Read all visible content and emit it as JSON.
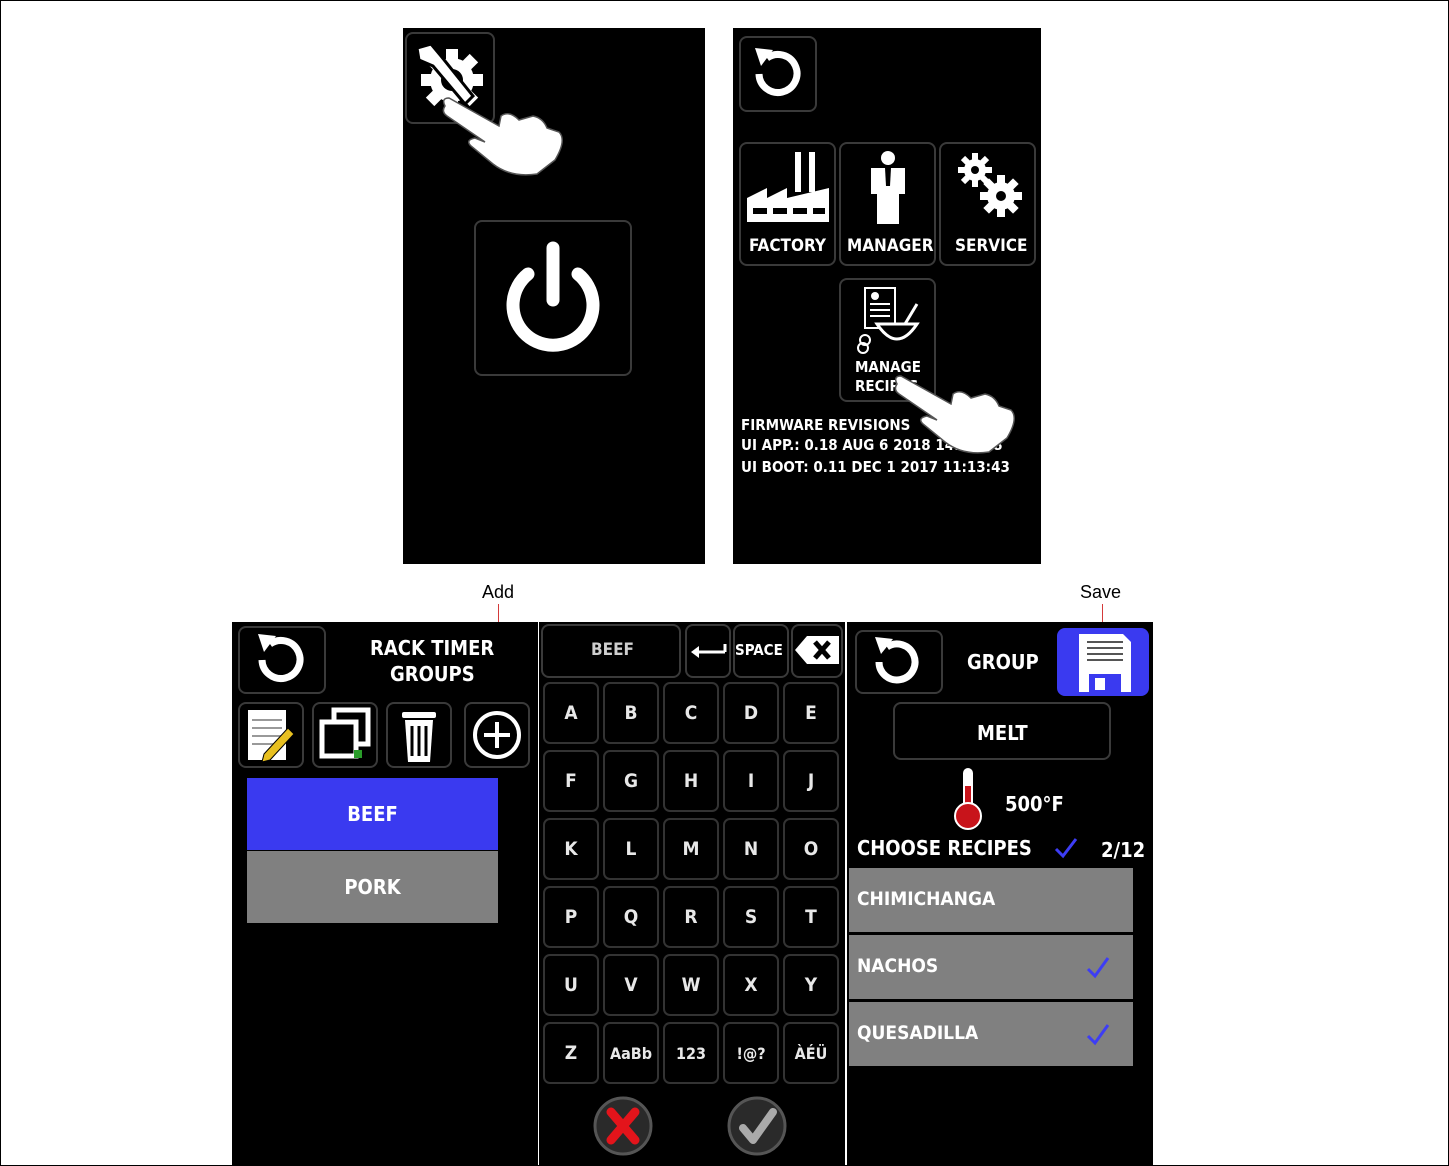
{
  "screen1": {},
  "screen2": {
    "menu": [
      "FACTORY",
      "MANAGER",
      "SERVICE"
    ],
    "manage_recipes": [
      "MANAGE",
      "RECIPES"
    ],
    "firmware": {
      "title": "FIRMWARE REVISIONS",
      "ui_app": "UI APP.: 0.18  AUG  6 2018 14:13:08",
      "ui_boot": "UI BOOT: 0.11  DEC  1 2017 11:13:43"
    }
  },
  "callouts": {
    "add": "Add",
    "save": "Save"
  },
  "screen3": {
    "title_line1": "RACK TIMER",
    "title_line2": "GROUPS",
    "groups": [
      {
        "name": "BEEF",
        "selected": true
      },
      {
        "name": "PORK",
        "selected": false
      }
    ]
  },
  "keyboard": {
    "input_value": "BEEF",
    "space_label": "SPACE",
    "rows": [
      [
        "A",
        "B",
        "C",
        "D",
        "E"
      ],
      [
        "F",
        "G",
        "H",
        "I",
        "J"
      ],
      [
        "K",
        "L",
        "M",
        "N",
        "O"
      ],
      [
        "P",
        "Q",
        "R",
        "S",
        "T"
      ],
      [
        "U",
        "V",
        "W",
        "X",
        "Y"
      ],
      [
        "Z",
        "AaBb",
        "123",
        "!@?",
        "ÀÉÜ"
      ]
    ]
  },
  "screen5": {
    "title": "GROUP",
    "group_name": "MELT",
    "temperature": "500°F",
    "choose_label": "CHOOSE RECIPES",
    "count": "2/12",
    "recipes": [
      {
        "name": "CHIMICHANGA",
        "checked": false
      },
      {
        "name": "NACHOS",
        "checked": true
      },
      {
        "name": "QUESADILLA",
        "checked": true
      }
    ]
  },
  "colors": {
    "accent_blue": "#3a3af0",
    "row_gray": "#808080",
    "check_blue": "#3d3df5",
    "therm_red": "#c8141b",
    "cancel_red": "#e3141b"
  }
}
